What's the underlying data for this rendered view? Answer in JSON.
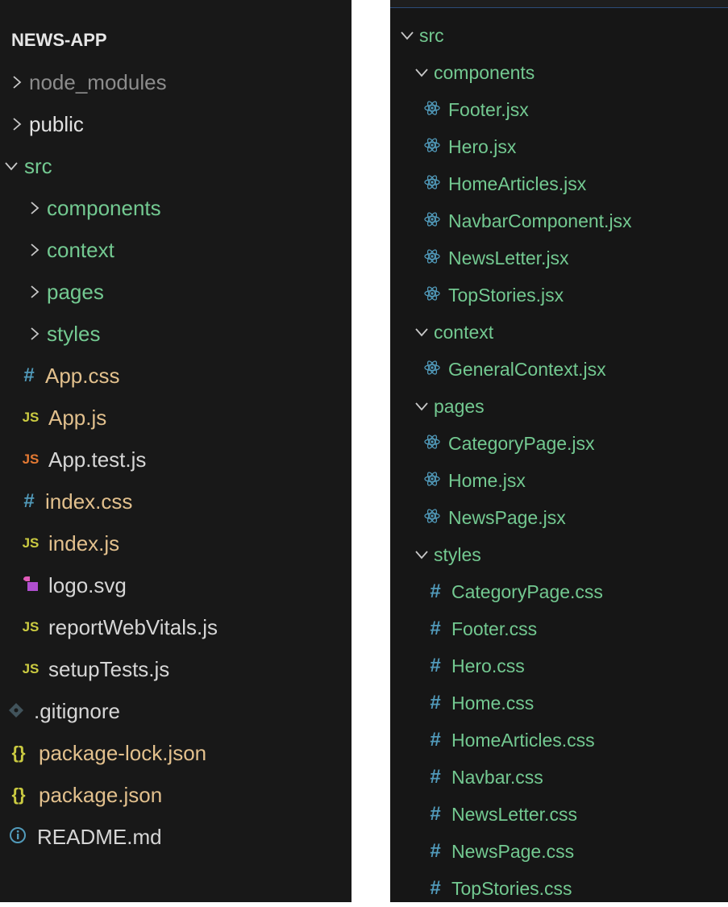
{
  "left": {
    "title": "NEWS-APP",
    "rows": [
      {
        "label": "node_modules",
        "type": "folder",
        "color": "#8c8c8c"
      },
      {
        "label": "public",
        "type": "folder"
      },
      {
        "label": "src",
        "type": "folder-open",
        "color": "#73c991"
      },
      {
        "label": "components",
        "type": "folder",
        "color": "#73c991"
      },
      {
        "label": "context",
        "type": "folder",
        "color": "#73c991"
      },
      {
        "label": "pages",
        "type": "folder",
        "color": "#73c991"
      },
      {
        "label": "styles",
        "type": "folder",
        "color": "#73c991"
      },
      {
        "label": "App.css",
        "icon": "css-hash-icon"
      },
      {
        "label": "App.js",
        "icon": "js-icon"
      },
      {
        "label": "App.test.js",
        "icon": "js-test-icon"
      },
      {
        "label": "index.css",
        "icon": "css-hash-icon"
      },
      {
        "label": "index.js",
        "icon": "js-icon"
      },
      {
        "label": "logo.svg",
        "icon": "svg-icon"
      },
      {
        "label": "reportWebVitals.js",
        "icon": "js-icon"
      },
      {
        "label": "setupTests.js",
        "icon": "js-icon"
      },
      {
        "label": ".gitignore",
        "icon": "git-icon"
      },
      {
        "label": "package-lock.json",
        "icon": "json-icon"
      },
      {
        "label": "package.json",
        "icon": "json-icon"
      },
      {
        "label": "README.md",
        "icon": "info-icon"
      }
    ]
  },
  "right": {
    "rows": [
      {
        "label": "src"
      },
      {
        "label": "components"
      },
      {
        "label": "Footer.jsx"
      },
      {
        "label": "Hero.jsx"
      },
      {
        "label": "HomeArticles.jsx"
      },
      {
        "label": "NavbarComponent.jsx"
      },
      {
        "label": "NewsLetter.jsx"
      },
      {
        "label": "TopStories.jsx"
      },
      {
        "label": "context"
      },
      {
        "label": "GeneralContext.jsx"
      },
      {
        "label": "pages"
      },
      {
        "label": "CategoryPage.jsx"
      },
      {
        "label": "Home.jsx"
      },
      {
        "label": "NewsPage.jsx"
      },
      {
        "label": "styles"
      },
      {
        "label": "CategoryPage.css"
      },
      {
        "label": "Footer.css"
      },
      {
        "label": "Hero.css"
      },
      {
        "label": "Home.css"
      },
      {
        "label": "HomeArticles.css"
      },
      {
        "label": "Navbar.css"
      },
      {
        "label": "NewsLetter.css"
      },
      {
        "label": "NewsPage.css"
      },
      {
        "label": "TopStories.css"
      }
    ]
  },
  "icons": {
    "js": "JS",
    "hash": "#",
    "json": "{}"
  }
}
